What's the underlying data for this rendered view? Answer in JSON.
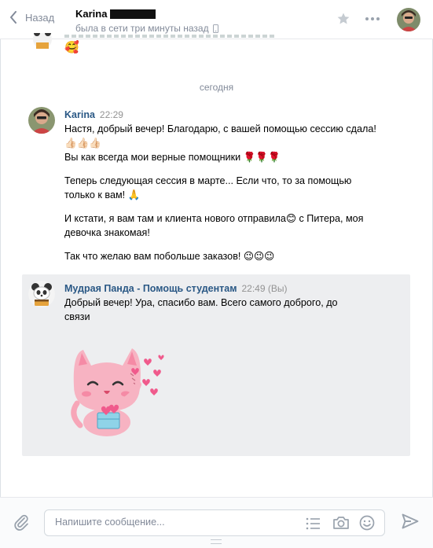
{
  "header": {
    "back_label": "Назад",
    "peer_name": "Karina",
    "peer_status": "была в сети три минуты назад"
  },
  "partial_message": {
    "emoji": "🥰"
  },
  "date_separator": "сегодня",
  "messages": [
    {
      "author": "Karina",
      "time": "22:29",
      "paragraphs": [
        "Настя, добрый вечер! Благодарю, с вашей помощью сессию сдала! 👍🏻👍🏻👍🏻",
        "Вы как всегда мои верные помощники 🌹🌹🌹",
        "Теперь следующая сессия в марте... Если что, то за помощью только к вам! 🙏",
        "И кстати, я вам там и клиента нового отправила😊 с Питера, моя девочка знакомая!",
        "Так что желаю вам побольше заказов! 😉😉😉"
      ]
    },
    {
      "author": "Мудрая Панда - Помощь студентам",
      "time": "22:49 (Вы)",
      "paragraphs": [
        "Добрый вечер! Ура, спасибо вам. Всего самого доброго, до связи"
      ],
      "sticker": "pink-cat-sticker"
    }
  ],
  "composer": {
    "placeholder": "Напишите сообщение..."
  },
  "colors": {
    "link": "#2a5885",
    "muted": "#828a99",
    "own_message_bg": "#edeef0",
    "sticker_pink": "#f7a6b8"
  }
}
